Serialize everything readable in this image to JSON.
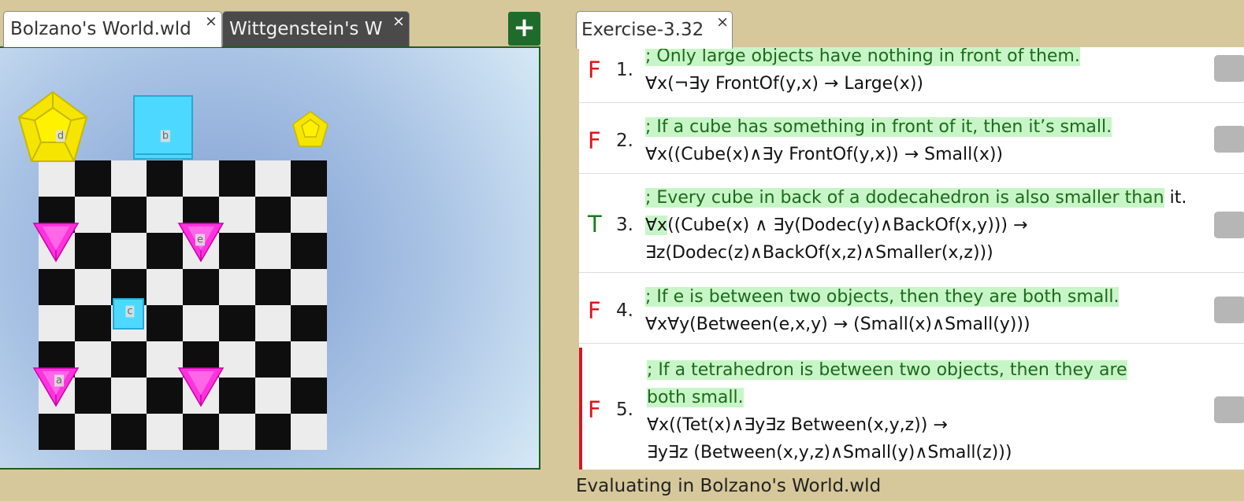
{
  "world_tabs": [
    {
      "label": "Bolzano's World.wld",
      "close": "×",
      "active": true
    },
    {
      "label": "Wittgenstein's W",
      "close": "×",
      "active": false
    }
  ],
  "add_tab_label": "+",
  "exercise_tab": {
    "label": "Exercise-3.32",
    "close": "×"
  },
  "world_objects": [
    {
      "name": "d",
      "shape": "dodecahedron",
      "size": "large",
      "color": "#f5e500",
      "col": 0,
      "row": 0
    },
    {
      "name": "b",
      "shape": "cube",
      "size": "large",
      "color": "#4dd9ff",
      "col": 3,
      "row": 0
    },
    {
      "name": "",
      "shape": "dodecahedron",
      "size": "small",
      "color": "#f5e500",
      "col": 7,
      "row": 0
    },
    {
      "name": "",
      "shape": "tetrahedron",
      "size": "medium",
      "color": "#ff33dd",
      "col": 0,
      "row": 3
    },
    {
      "name": "e",
      "shape": "tetrahedron",
      "size": "medium",
      "color": "#ff33dd",
      "col": 4,
      "row": 3
    },
    {
      "name": "c",
      "shape": "cube",
      "size": "small",
      "color": "#4dd9ff",
      "col": 2,
      "row": 5
    },
    {
      "name": "a",
      "shape": "tetrahedron",
      "size": "medium",
      "color": "#ff33dd",
      "col": 0,
      "row": 7
    },
    {
      "name": "",
      "shape": "tetrahedron",
      "size": "medium",
      "color": "#ff33dd",
      "col": 4,
      "row": 7
    }
  ],
  "sentences": [
    {
      "truth": "F",
      "number": "1.",
      "comment": "; Only large objects have nothing in front of them.",
      "formula": [
        "∀x(¬∃y FrontOf(y,x) → Large(x))"
      ]
    },
    {
      "truth": "F",
      "number": "2.",
      "comment": "; If a cube has something in front of it, then it’s small.",
      "formula": [
        "∀x((Cube(x)∧∃y FrontOf(y,x)) → Small(x))"
      ]
    },
    {
      "truth": "T",
      "number": "3.",
      "comment": "; Every cube in back of a dodecahedron is also smaller than",
      "comment_tail": " it.",
      "formula_hl": "∀x",
      "formula": [
        "((Cube(x) ∧ ∃y(Dodec(y)∧BackOf(x,y))) →",
        "∃z(Dodec(z)∧BackOf(x,z)∧Smaller(x,z)))"
      ]
    },
    {
      "truth": "F",
      "number": "4.",
      "comment": "; If e is between two objects, then they are both small.",
      "formula": [
        "∀x∀y(Between(e,x,y) → (Small(x)∧Small(y)))"
      ]
    },
    {
      "truth": "F",
      "number": "5.",
      "comment": [
        "; If a tetrahedron is between two objects, then they are",
        "both small."
      ],
      "formula": [
        "∀x((Tet(x)∧∃y∃z Between(x,y,z)) →",
        "∃y∃z (Between(x,y,z)∧Small(y)∧Small(z)))"
      ],
      "selected": true
    }
  ],
  "status": "Evaluating in Bolzano's World.wld"
}
